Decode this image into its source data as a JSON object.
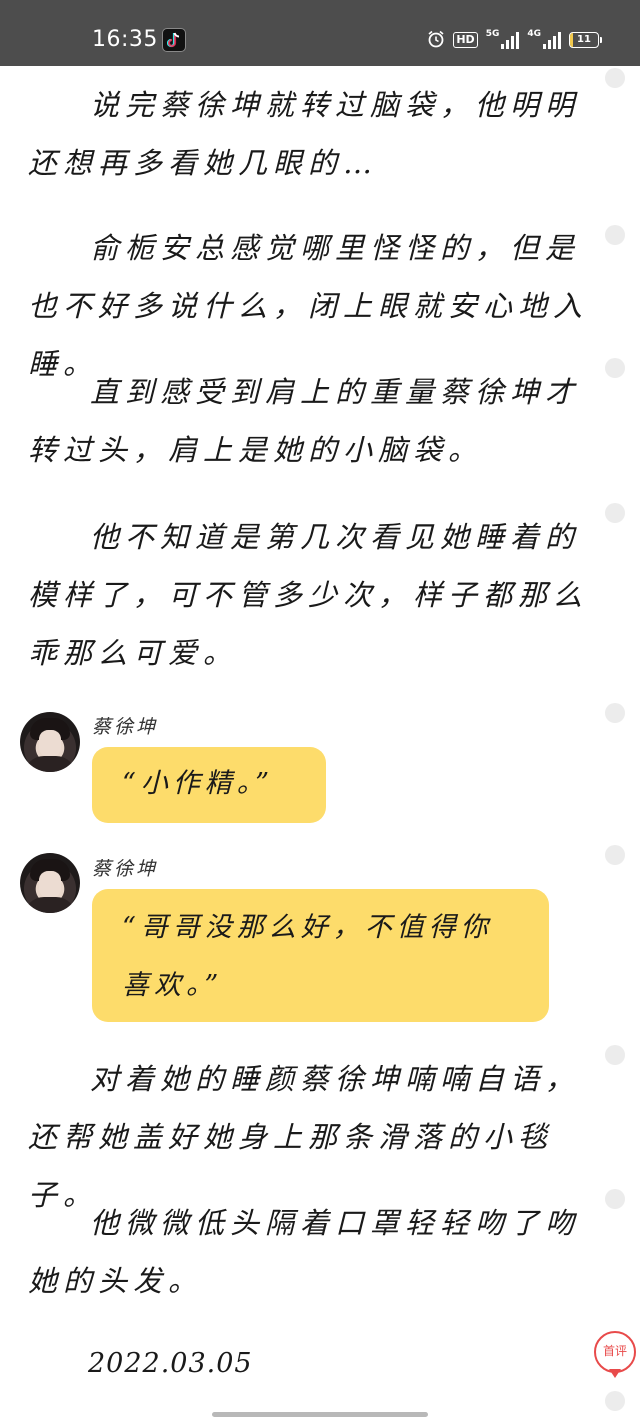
{
  "status_bar": {
    "time": "16:35",
    "app_icon": "tiktok-icon",
    "alarm_icon": "alarm-clock-icon",
    "hd_label": "HD",
    "network_1": "5G",
    "network_2": "4G",
    "battery_level": "11",
    "battery_fraction": 0.11
  },
  "article": {
    "paragraphs": [
      "说完蔡徐坤就转过脑袋，他明明还想再多看她几眼的…",
      "俞栀安总感觉哪里怪怪的，但是也不好多说什么，闭上眼就安心地入睡。",
      "直到感受到肩上的重量蔡徐坤才转过头，肩上是她的小脑袋。",
      "他不知道是第几次看见她睡着的模样了，可不管多少次，样子都那么乖那么可爱。"
    ],
    "chat": [
      {
        "speaker": "蔡徐坤",
        "message": "“小作精。”"
      },
      {
        "speaker": "蔡徐坤",
        "message": "“哥哥没那么好，不值得你喜欢。”"
      }
    ],
    "paragraphs_after": [
      "对着她的睡颜蔡徐坤喃喃自语，还帮她盖好她身上那条滑落的小毯子。",
      "他微微低头隔着口罩轻轻吻了吻她的头发。"
    ],
    "date": "2022.03.05"
  },
  "fab": {
    "label": "首评"
  },
  "colors": {
    "status_bar_bg": "#4d4d4d",
    "bubble": "#fddc6b",
    "fab_accent": "#e84a4a",
    "comment_dot": "#ececec"
  }
}
